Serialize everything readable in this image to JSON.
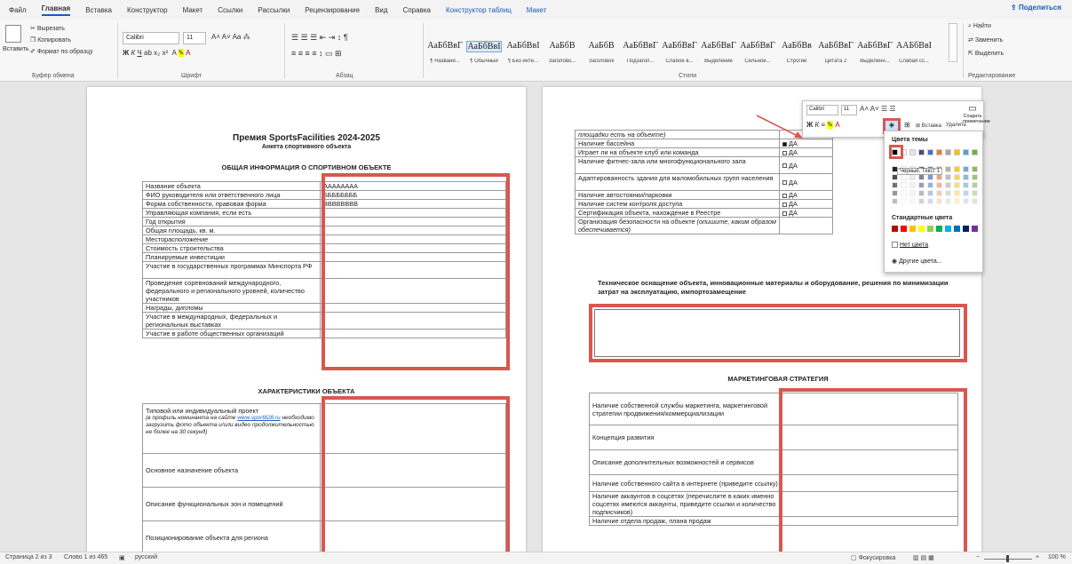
{
  "tabs": [
    "Файл",
    "Главная",
    "Вставка",
    "Конструктор",
    "Макет",
    "Ссылки",
    "Рассылки",
    "Рецензирование",
    "Вид",
    "Справка",
    "Конструктор таблиц",
    "Макет"
  ],
  "share": "Поделиться",
  "clipboard": {
    "paste": "Вставить",
    "cut": "Вырезать",
    "copy": "Копировать",
    "format": "Формат по образцу",
    "group": "Буфер обмена"
  },
  "font": {
    "name": "Calibri",
    "size": "11",
    "group": "Шрифт"
  },
  "paragraph": {
    "group": "Абзац"
  },
  "styles": {
    "group": "Стили",
    "items": [
      {
        "preview": "АаБбВвГ",
        "label": "¶ Названи..."
      },
      {
        "preview": "АаБбВвІ",
        "label": "¶ Обычный"
      },
      {
        "preview": "АаБбВвІ",
        "label": "¶ Без инте..."
      },
      {
        "preview": "АаБбВ",
        "label": "Заголово..."
      },
      {
        "preview": "АаБбВ",
        "label": "Заголовок"
      },
      {
        "preview": "АаБбВвГ",
        "label": "Подзагол..."
      },
      {
        "preview": "АаБбВвГ",
        "label": "Слабое в..."
      },
      {
        "preview": "АаБбВвГ",
        "label": "Выделение"
      },
      {
        "preview": "АаБбВвГ",
        "label": "Сильное..."
      },
      {
        "preview": "АаБбВв",
        "label": "Строгий"
      },
      {
        "preview": "АаБбВвГ",
        "label": "Цитата 2"
      },
      {
        "preview": "АаБбВвГ",
        "label": "Выделенн..."
      },
      {
        "preview": "ААБбВвІ",
        "label": "Слабая сс..."
      }
    ]
  },
  "editing": {
    "find": "Найти",
    "replace": "Заменить",
    "select": "Выделить",
    "group": "Редактирование"
  },
  "left_page": {
    "title": "Премия SportsFacilities 2024-2025",
    "subtitle": "Анкета спортивного объекта",
    "section1": "ОБЩАЯ ИНФОРМАЦИЯ О СПОРТИВНОМ ОБЪЕКТЕ",
    "rows1": [
      {
        "label": "Название объекта",
        "value": "АААААААА"
      },
      {
        "label": "ФИО руководителя или ответственного лица",
        "value": "ББББББББ"
      },
      {
        "label": "Форма собственности, правовая форма",
        "value": "ВВВВВВВВ"
      },
      {
        "label": "Управляющая компания, если есть",
        "value": ""
      },
      {
        "label": "Год открытия",
        "value": ""
      },
      {
        "label": "Общая площадь, кв. м.",
        "value": ""
      },
      {
        "label": "Месторасположение",
        "value": ""
      },
      {
        "label": "Стоимость строительства",
        "value": ""
      },
      {
        "label": "Планируемые инвестиции",
        "value": ""
      },
      {
        "label": "Участие в государственных программах Минспорта РФ",
        "value": ""
      },
      {
        "label": "Проведение соревнований международного, федерального и регионального уровней, количество участников",
        "value": ""
      },
      {
        "label": "Награды, дипломы",
        "value": ""
      },
      {
        "label": "Участие в международных, федеральных и региональных выставках",
        "value": ""
      },
      {
        "label": "Участие в работе общественных организаций",
        "value": ""
      }
    ],
    "section2": "ХАРАКТЕРИСТИКИ ОБЪЕКТА",
    "row2_title": "Типовой или индивидуальный проект",
    "row2_note1": "(в профиль номинанта на сайте ",
    "row2_link": "www.sport828.ru",
    "row2_note2": " необходимо загрузить фото объекта и/или видео продолжительностью не более на 30 секунд)",
    "rows2": [
      "Основное назначение объекта",
      "Описание функциональных зон и помещений",
      "Позиционирование объекта для региона"
    ]
  },
  "right_page": {
    "top_cont": "площадки есть на объекте)",
    "rows1": [
      {
        "label": "Наличие бассейна",
        "value": "ДА"
      },
      {
        "label": "Играет ли на объекте клуб или команда",
        "value": "ДА"
      },
      {
        "label": "Наличие фитнес-зала или многофункционального зала",
        "value": "ДА"
      },
      {
        "label": "Адаптированность здания для маломобильных групп населения",
        "value": "ДА"
      },
      {
        "label": "Наличие автостоянки/парковки",
        "value": "ДА"
      },
      {
        "label": "Наличие систем контроля доступа",
        "value": "ДА"
      },
      {
        "label": "Сертификация объекта, нахождение в Реестре",
        "value": "ДА"
      }
    ],
    "security_label": "Организация безопасности на объекте",
    "security_note": "(опишите, каким образом обеспечивается)",
    "tech_heading": "Техническое оснащение объекта, инновационные материалы и оборудование, решения по минимизации затрат на эксплуатацию, импортозамещение",
    "marketing_heading": "МАРКЕТИНГОВАЯ СТРАТЕГИЯ",
    "marketing_rows": [
      "Наличие собственной службы маркетинга, маркетинговой стратегии продвижения/коммерциализации",
      "Концепция развития",
      "Описание дополнительных возможностей и сервисов",
      "Наличие собственного сайта в интернете (приведите ссылку)",
      "Наличие аккаунтов в соцсетях (перечислите в каких именно соцсетях имеются аккаунты, приведите ссылки и количество подписчиков)",
      "Наличие отдела продаж, плана продаж"
    ]
  },
  "minitoolbar": {
    "font": "Calibri",
    "size": "11",
    "insert": "Вставка",
    "delete": "Удалить",
    "comment": "Создать примечание"
  },
  "color_popup": {
    "theme": "Цвета темы",
    "tooltip": "Черный, Текст 1",
    "standard": "Стандартные цвета",
    "no_color": "Нет цвета",
    "more": "Другие цвета..."
  },
  "theme_colors": [
    "#000000",
    "#ffffff",
    "#e7e6e6",
    "#44546a",
    "#4472c4",
    "#ed7d31",
    "#a5a5a5",
    "#ffc000",
    "#5b9bd5",
    "#70ad47"
  ],
  "standard_colors": [
    "#c00000",
    "#ff0000",
    "#ffc000",
    "#ffff00",
    "#92d050",
    "#00b050",
    "#00b0f0",
    "#0070c0",
    "#002060",
    "#7030a0"
  ],
  "status": {
    "page": "Страница 2 из 3",
    "words": "Слово 1 из 465",
    "lang": "русский",
    "focus": "Фокусировка",
    "zoom": "100 %"
  }
}
